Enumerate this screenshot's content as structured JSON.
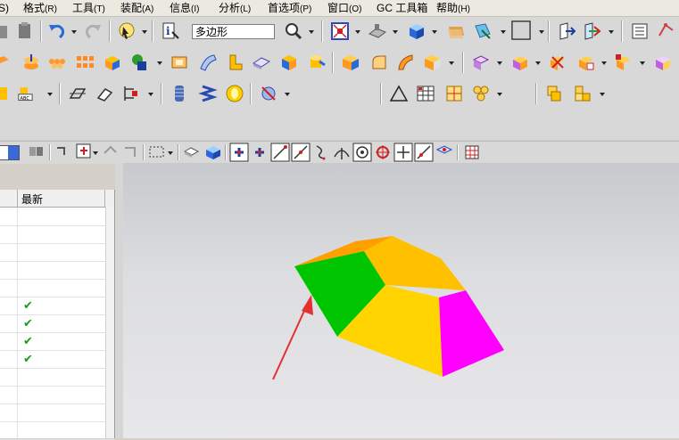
{
  "menubar": {
    "items": [
      {
        "label": "S)",
        "accel": ""
      },
      {
        "label": "格式",
        "accel": "(R)"
      },
      {
        "label": "工具",
        "accel": "(T)"
      },
      {
        "label": "装配",
        "accel": "(A)"
      },
      {
        "label": "信息",
        "accel": "(I)"
      },
      {
        "label": "分析",
        "accel": "(L)"
      },
      {
        "label": "首选项",
        "accel": "(P)"
      },
      {
        "label": "窗口",
        "accel": "(O)"
      },
      {
        "label": "GC 工具箱",
        "accel": ""
      },
      {
        "label": "帮助",
        "accel": "(H)"
      }
    ]
  },
  "toolbar": {
    "shape_input": "多边形"
  },
  "part_navigator": {
    "column_header": "最新",
    "rows": [
      "",
      "",
      "",
      "",
      "",
      "✔",
      "✔",
      "✔",
      "✔",
      "",
      "",
      "",
      ""
    ]
  },
  "viewport": {
    "solid_colors": {
      "top": "#ffc000",
      "right": "#ff00ff",
      "front": "#ffd400",
      "left": "#00c400",
      "edge": "#ffa000"
    },
    "arrow_color": "#e53030"
  }
}
